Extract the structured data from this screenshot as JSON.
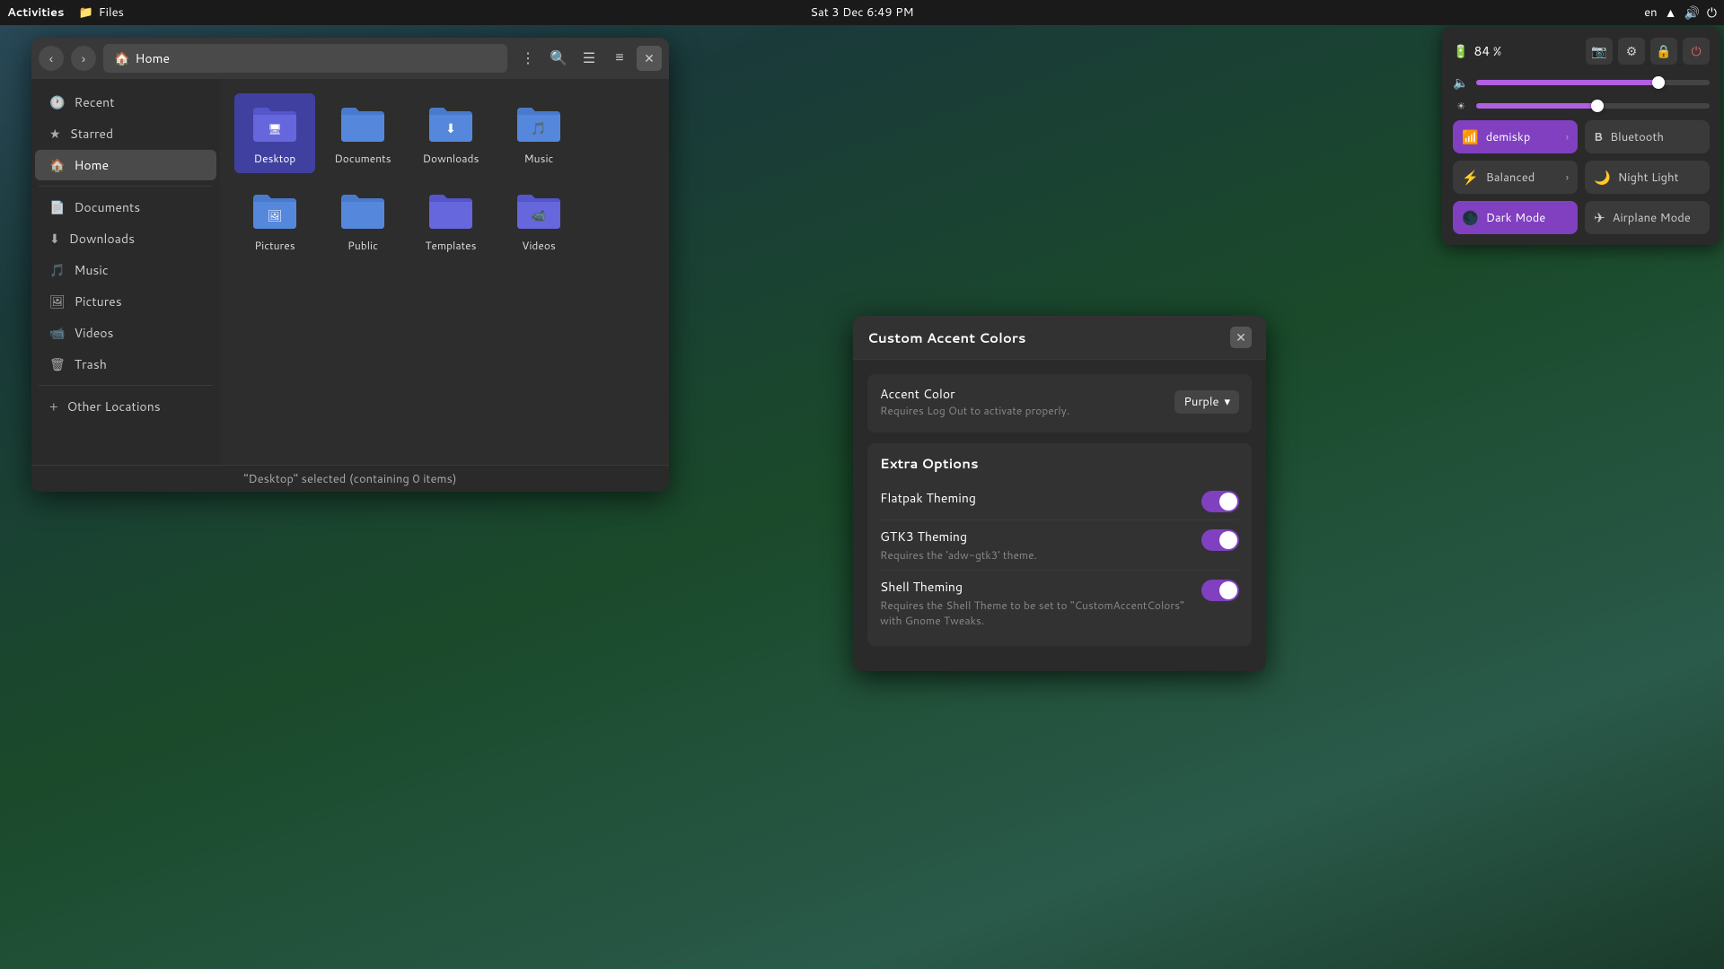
{
  "topbar": {
    "activities": "Activities",
    "app_icon": "📁",
    "app_name": "Files",
    "datetime": "Sat 3 Dec  6:49 PM",
    "lang": "en",
    "wifi_icon": "wifi",
    "volume_icon": "volume",
    "power_icon": "power"
  },
  "file_manager": {
    "title": "Home",
    "back_label": "‹",
    "forward_label": "›",
    "home_icon": "🏠",
    "menu_icon": "⋮",
    "search_icon": "🔍",
    "view_icon": "☰",
    "list_icon": "≡",
    "close_icon": "✕",
    "status": "\"Desktop\" selected (containing 0 items)",
    "sidebar": {
      "items": [
        {
          "id": "recent",
          "label": "Recent",
          "icon": "🕐"
        },
        {
          "id": "starred",
          "label": "Starred",
          "icon": "★"
        },
        {
          "id": "home",
          "label": "Home",
          "icon": "🏠",
          "active": true
        },
        {
          "id": "documents",
          "label": "Documents",
          "icon": "📄"
        },
        {
          "id": "downloads",
          "label": "Downloads",
          "icon": "⬇"
        },
        {
          "id": "music",
          "label": "Music",
          "icon": "🎵"
        },
        {
          "id": "pictures",
          "label": "Pictures",
          "icon": "🖼"
        },
        {
          "id": "videos",
          "label": "Videos",
          "icon": "📹"
        },
        {
          "id": "trash",
          "label": "Trash",
          "icon": "🗑"
        },
        {
          "id": "other-locations",
          "label": "Other Locations",
          "icon": "+"
        }
      ]
    },
    "folders": [
      {
        "id": "desktop",
        "label": "Desktop",
        "icon": "folder-desktop",
        "selected": true
      },
      {
        "id": "documents",
        "label": "Documents",
        "icon": "folder-documents"
      },
      {
        "id": "downloads",
        "label": "Downloads",
        "icon": "folder-downloads"
      },
      {
        "id": "music",
        "label": "Music",
        "icon": "folder-music"
      },
      {
        "id": "pictures",
        "label": "Pictures",
        "icon": "folder-pictures"
      },
      {
        "id": "public",
        "label": "Public",
        "icon": "folder-public"
      },
      {
        "id": "templates",
        "label": "Templates",
        "icon": "folder-templates"
      },
      {
        "id": "videos",
        "label": "Videos",
        "icon": "folder-videos"
      }
    ]
  },
  "system_panel": {
    "battery_pct": "84 %",
    "battery_icon": "🔋",
    "screenshot_icon": "📷",
    "settings_icon": "⚙",
    "lock_icon": "🔒",
    "power_icon": "⏻",
    "volume_slider_pct": 78,
    "brightness_slider_pct": 52,
    "tiles": [
      {
        "id": "wifi",
        "label": "demiskp",
        "icon": "📶",
        "active": true,
        "arrow": true
      },
      {
        "id": "bluetooth",
        "label": "Bluetooth",
        "icon": "𝔹",
        "active": false
      },
      {
        "id": "power-mode",
        "label": "Balanced",
        "icon": "⚡",
        "active": false,
        "arrow": true
      },
      {
        "id": "night-light",
        "label": "Night Light",
        "icon": "🌙",
        "active": false
      },
      {
        "id": "dark-mode",
        "label": "Dark Mode",
        "icon": "🌑",
        "active": true
      },
      {
        "id": "airplane-mode",
        "label": "Airplane Mode",
        "icon": "✈",
        "active": false
      }
    ]
  },
  "accent_dialog": {
    "title": "Custom Accent Colors",
    "close_label": "✕",
    "accent_color_label": "Accent Color",
    "accent_color_sublabel": "Requires Log Out to activate properly.",
    "accent_color_value": "Purple",
    "extra_options_label": "Extra Options",
    "toggles": [
      {
        "id": "flatpak-theming",
        "label": "Flatpak Theming",
        "sublabel": "",
        "enabled": true
      },
      {
        "id": "gtk3-theming",
        "label": "GTK3 Theming",
        "sublabel": "Requires the 'adw-gtk3' theme.",
        "enabled": true
      },
      {
        "id": "shell-theming",
        "label": "Shell Theming",
        "sublabel": "Requires the Shell Theme to be set to \"CustomAccentColors\" with Gnome Tweaks.",
        "enabled": true
      }
    ]
  }
}
